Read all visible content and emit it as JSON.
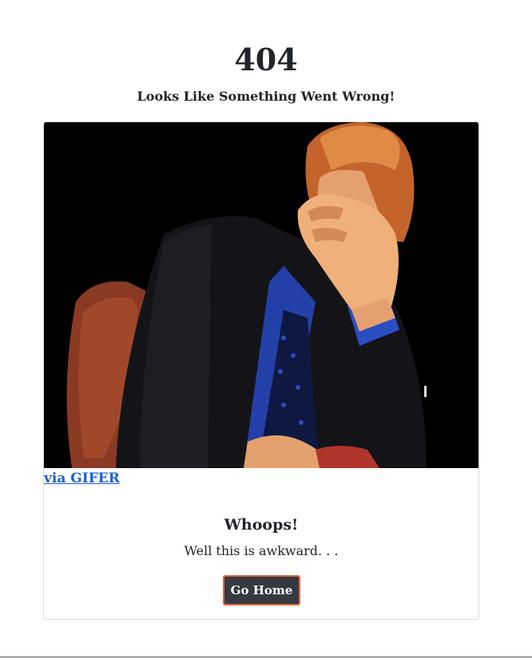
{
  "header": {
    "title": "404",
    "subtitle": "Looks Like Something Went Wrong!"
  },
  "card": {
    "image_icon": "facepalm-gif",
    "via_link": "via GIFER",
    "title": "Whoops!",
    "text": "Well this is awkward. . .",
    "button_label": "Go Home"
  },
  "colors": {
    "text": "#212529",
    "link": "#1a5fd6",
    "button_bg": "#343a40",
    "button_border": "#e8653a"
  }
}
